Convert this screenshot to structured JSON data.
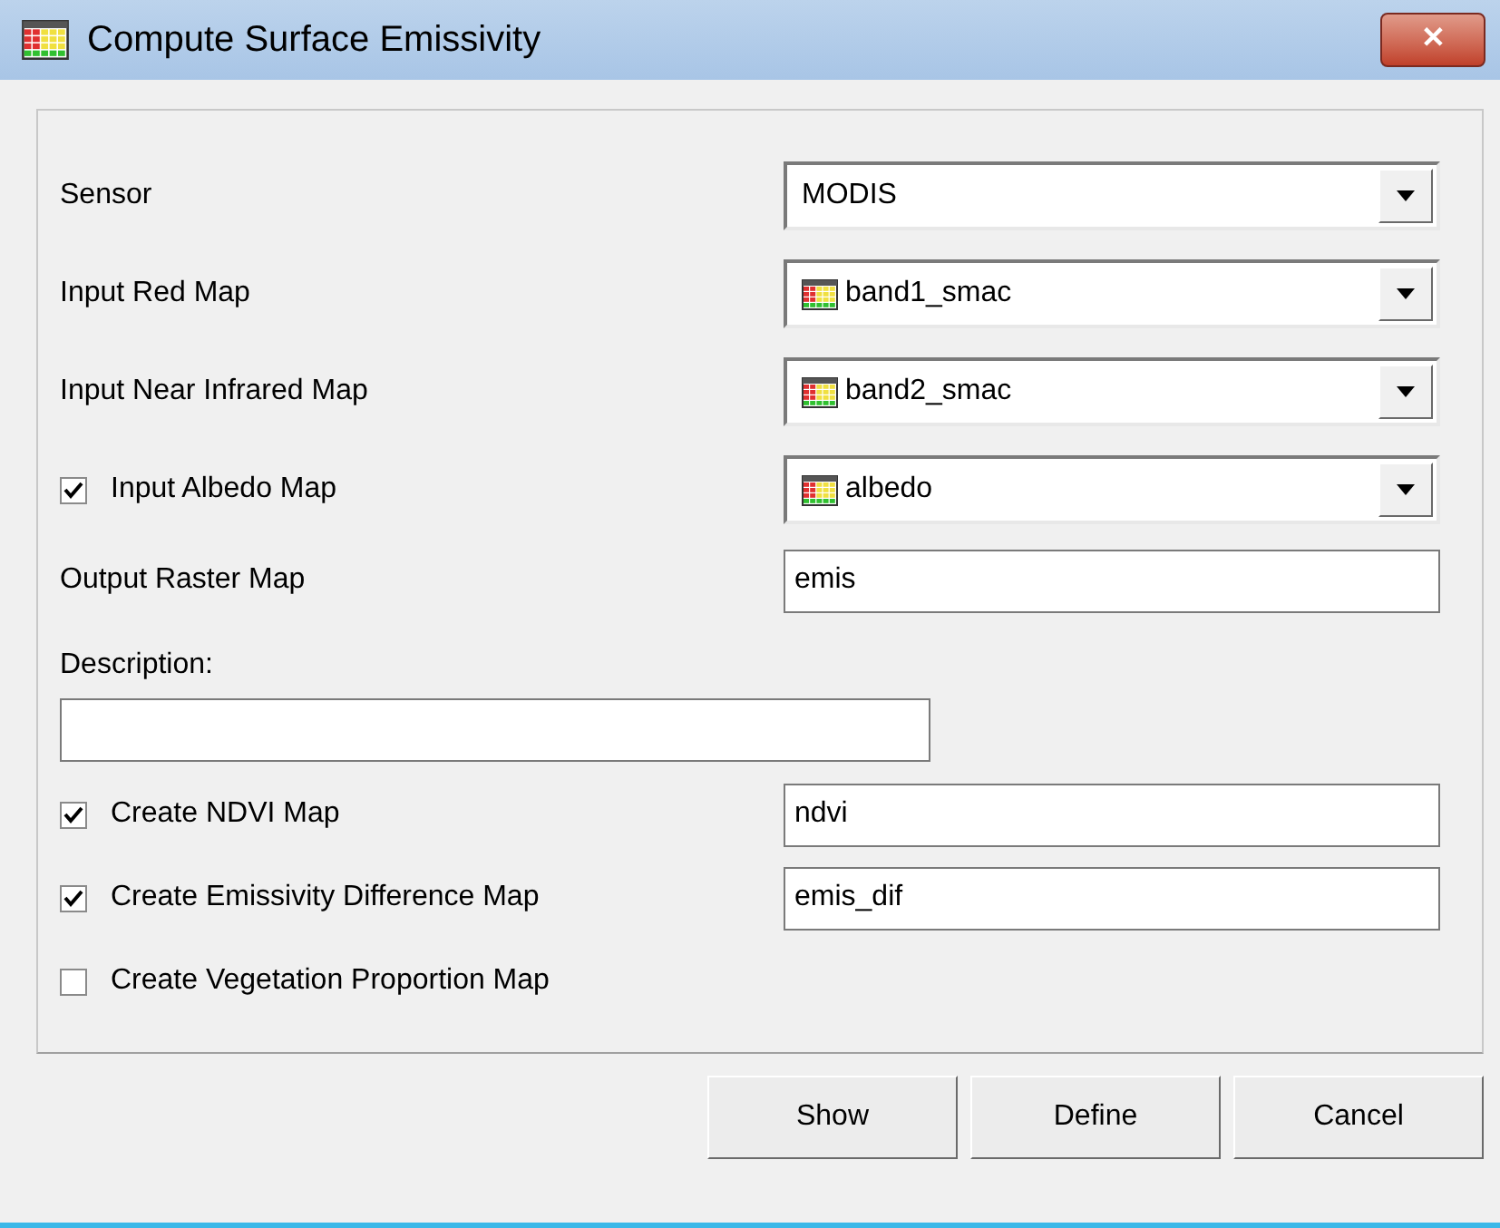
{
  "window": {
    "title": "Compute Surface Emissivity",
    "close": "✕"
  },
  "rows": [
    {
      "kind": "dropdown",
      "label": "Sensor",
      "value": "MODIS"
    },
    {
      "kind": "map-dropdown",
      "label": "Input Red Map",
      "value": "band1_smac"
    },
    {
      "kind": "map-dropdown",
      "label": "Input Near Infrared Map",
      "value": "band2_smac"
    },
    {
      "kind": "check-map-dropdown",
      "label": "Input Albedo Map",
      "checked": true,
      "value": "albedo"
    },
    {
      "kind": "text",
      "label": "Output Raster Map",
      "value": "emis"
    },
    {
      "kind": "description",
      "label": "Description:"
    },
    {
      "kind": "check-text",
      "label": "Create NDVI Map",
      "checked": true,
      "value": "ndvi"
    },
    {
      "kind": "check-text",
      "label": "Create Emissivity Difference Map",
      "checked": true,
      "value": "emis_dif"
    },
    {
      "kind": "check",
      "label": "Create Vegetation Proportion Map",
      "checked": false
    }
  ],
  "buttons": [
    "Show",
    "Define",
    "Cancel"
  ]
}
